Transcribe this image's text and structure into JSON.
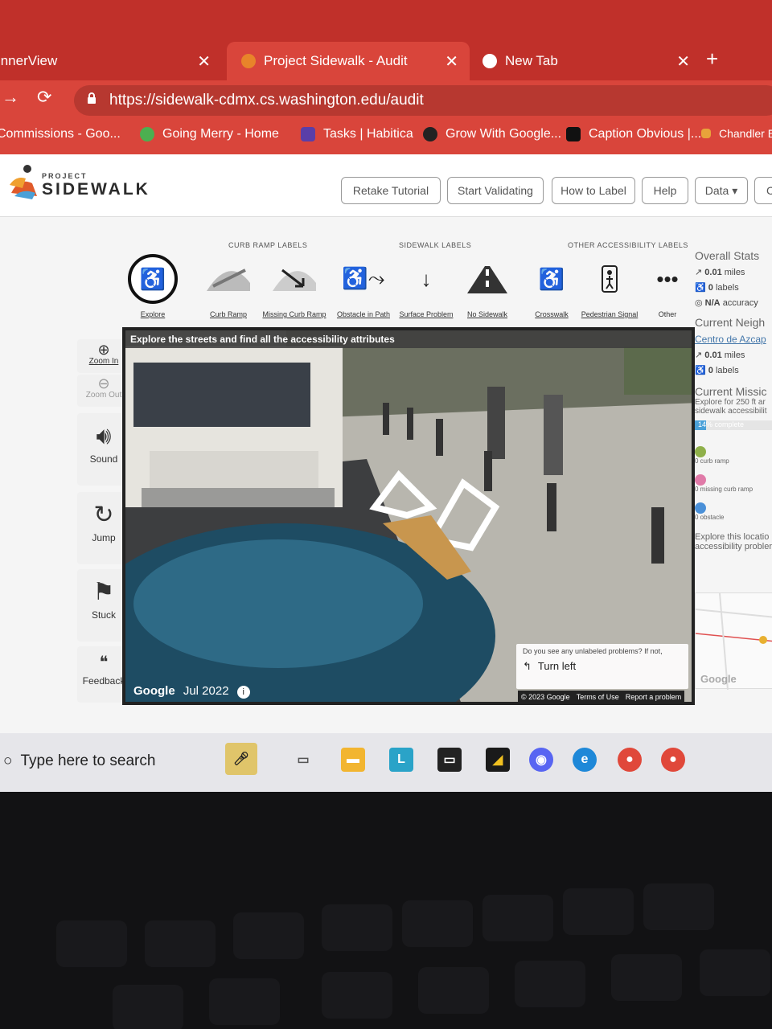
{
  "browser": {
    "tabs": [
      {
        "title": "InnerView"
      },
      {
        "title": "Project Sidewalk - Audit"
      },
      {
        "title": "New Tab"
      }
    ],
    "url": "https://sidewalk-cdmx.cs.washington.edu/audit",
    "bookmarks": [
      "Commissions - Goo...",
      "Going Merry - Home",
      "Tasks | Habitica",
      "Grow With Google...",
      "Caption Obvious |...",
      "Chandler E"
    ]
  },
  "header": {
    "logo_small": "PROJECT",
    "logo_big": "SIDEWALK",
    "buttons": [
      "Retake Tutorial",
      "Start Validating",
      "How to Label",
      "Help",
      "Data ▾",
      "C"
    ]
  },
  "ribbon": {
    "sections": [
      "CURB RAMP LABELS",
      "SIDEWALK LABELS",
      "OTHER ACCESSIBILITY LABELS"
    ],
    "labels": [
      "Explore",
      "Curb Ramp",
      "Missing Curb Ramp",
      "Obstacle in Path",
      "Surface Problem",
      "No Sidewalk",
      "Crosswalk",
      "Pedestrian Signal",
      "Other"
    ]
  },
  "tools": {
    "zoom_in": "Zoom In",
    "zoom_out": "Zoom Out",
    "sound": "Sound",
    "jump": "Jump",
    "stuck": "Stuck",
    "feedback": "Feedback"
  },
  "streetview": {
    "banner": "Explore the streets and find all the accessibility attributes",
    "google": "Google",
    "date": "Jul 2022",
    "hint_question": "Do you see any unlabeled problems? If not,",
    "hint_action": "Turn left",
    "attribution": [
      "© 2023 Google",
      "Terms of Use",
      "Report a problem"
    ]
  },
  "stats": {
    "overall_title": "Overall Stats",
    "overall_miles": "0.01",
    "overall_miles_unit": "miles",
    "overall_labels": "0",
    "overall_labels_unit": "labels",
    "accuracy": "N/A",
    "accuracy_unit": "accuracy",
    "neigh_title": "Current Neigh",
    "neigh_name": "Centro de Azcap",
    "neigh_miles": "0.01",
    "neigh_miles_unit": "miles",
    "neigh_labels": "0",
    "neigh_labels_unit": "labels",
    "mission_title": "Current Missic",
    "mission_desc1": "Explore for 250 ft ar",
    "mission_desc2": "sidewalk accessibilit",
    "mission_progress": 0.14,
    "mission_pct": "14%",
    "mission_word": "complete",
    "legend": [
      "0 curb ramp",
      "0 missing curb ramp",
      "0 obstacle"
    ],
    "explore_text1": "Explore this locatio",
    "explore_text2": "accessibility probler",
    "map_google": "Google"
  },
  "taskbar": {
    "search_placeholder": "Type here to search"
  },
  "colors": {
    "chrome_red": "#c0302a",
    "toolbar_red": "#d9453b",
    "accent_blue": "#4aa0d8"
  }
}
